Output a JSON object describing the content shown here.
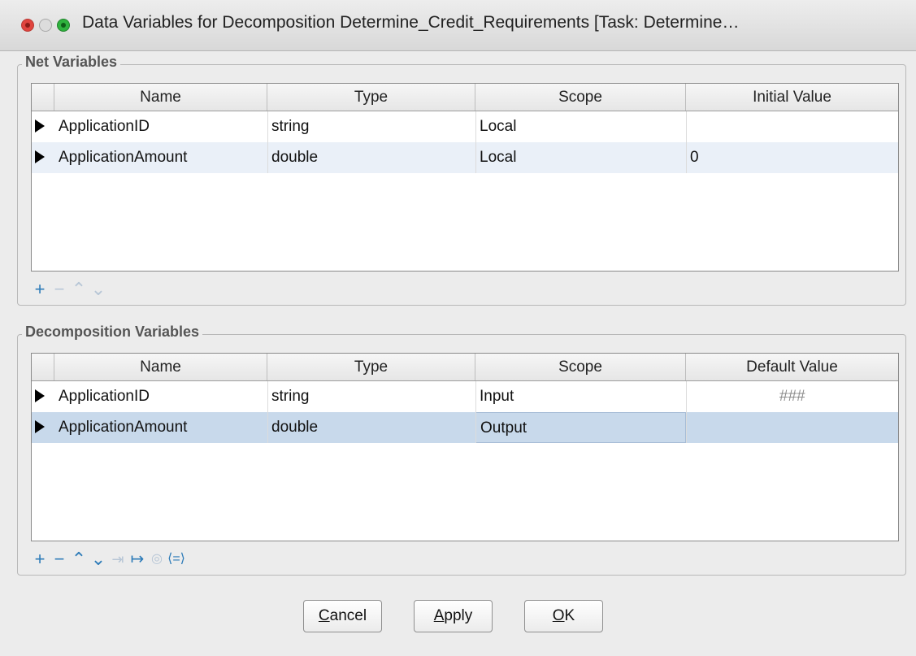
{
  "window": {
    "title": "Data Variables for Decomposition Determine_Credit_Requirements [Task: Determine…"
  },
  "net_variables": {
    "legend": "Net Variables",
    "columns": [
      "Name",
      "Type",
      "Scope",
      "Initial Value"
    ],
    "rows": [
      {
        "name": "ApplicationID",
        "type": "string",
        "scope": "Local",
        "value": ""
      },
      {
        "name": "ApplicationAmount",
        "type": "double",
        "scope": "Local",
        "value": "0"
      }
    ],
    "toolbar": [
      "add-icon",
      "remove-icon",
      "move-up-icon",
      "move-down-icon"
    ]
  },
  "decomposition_variables": {
    "legend": "Decomposition Variables",
    "columns": [
      "Name",
      "Type",
      "Scope",
      "Default Value"
    ],
    "rows": [
      {
        "name": "ApplicationID",
        "type": "string",
        "scope": "Input",
        "value": "###"
      },
      {
        "name": "ApplicationAmount",
        "type": "double",
        "scope": "Output",
        "value": ""
      }
    ],
    "selected_row": 1,
    "toolbar": [
      "add-icon",
      "remove-icon",
      "move-up-icon",
      "move-down-icon",
      "indent-icon",
      "map-icon",
      "target-icon",
      "equals-icon"
    ]
  },
  "buttons": {
    "cancel_pre": "",
    "cancel_mn": "C",
    "cancel_post": "ancel",
    "apply_pre": "",
    "apply_mn": "A",
    "apply_post": "pply",
    "ok_pre": "",
    "ok_mn": "O",
    "ok_post": "K"
  },
  "colors": {
    "accent": "#2d7bb8",
    "stripe": "#eaf0f8",
    "selection": "#c8d9eb"
  }
}
